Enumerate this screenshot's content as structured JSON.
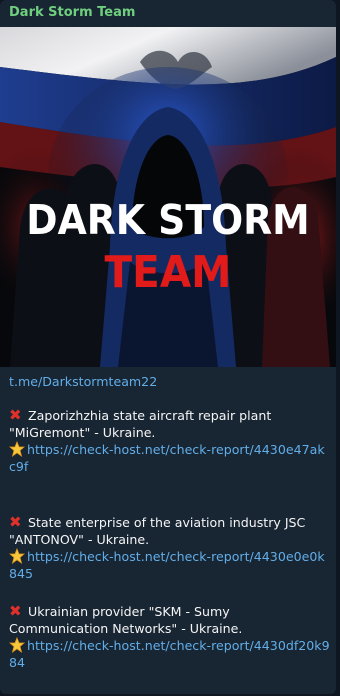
{
  "channel": {
    "name": "Dark Storm Team"
  },
  "hero": {
    "line1": "DARK STORM",
    "line2": "TEAM"
  },
  "channel_link": "t.me/Darkstormteam22",
  "posts": [
    {
      "title": "Zaporizhzhia state aircraft repair plant \"MiGremont\" - Ukraine.",
      "url": "https://check-host.net/check-report/4430e47akc9f"
    },
    {
      "title": "State enterprise of the aviation industry JSC \"ANTONOV\" - Ukraine.",
      "url": "https://check-host.net/check-report/4430e0e0k845"
    },
    {
      "title": "Ukrainian provider \"SKM - Sumy Communication Networks\" - Ukraine.",
      "url": "https://check-host.net/check-report/4430df20k984"
    }
  ],
  "icons": {
    "cross": "red-cross-mark-icon",
    "star": "glowing-star-icon"
  },
  "colors": {
    "accent_green": "#6fcf7f",
    "link_blue": "#62aee8",
    "brand_red": "#e11a1a"
  }
}
